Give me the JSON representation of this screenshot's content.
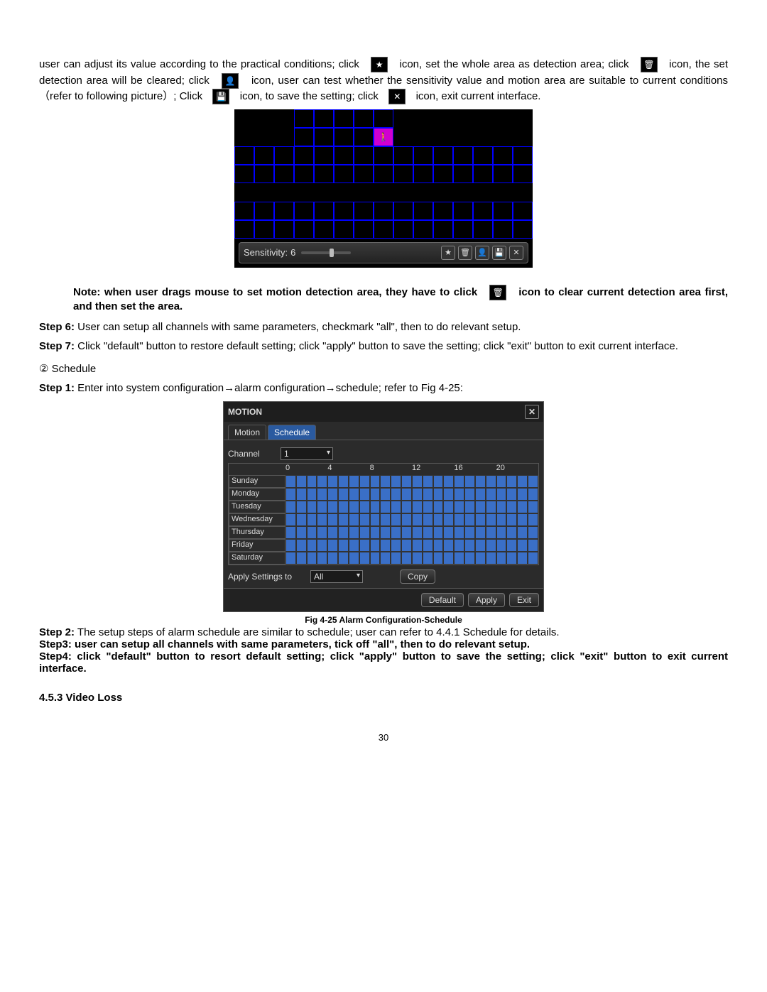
{
  "intro": {
    "p1a": "user can adjust its value according to the practical conditions; click",
    "p1b": "icon, set the whole area as detection area; click",
    "p1c": "icon, the set detection area will be cleared; click",
    "p1d": "icon, user can test whether the sensitivity value and motion area are suitable to current conditions（refer to following picture）; Click",
    "p1e": "icon, to save the setting; click",
    "p1f": "icon, exit current interface."
  },
  "icons": {
    "star": "★",
    "trash": "🗑",
    "person": "👤",
    "save": "💾",
    "close": "✕",
    "walk": "🚶"
  },
  "motion_bar": {
    "label": "Sensitivity:",
    "value": "6"
  },
  "note": {
    "a": "Note: when user drags mouse to set motion detection area, they have to click",
    "b": "icon to clear current detection area first, and then set the area."
  },
  "step6": {
    "label": "Step 6:",
    "text": " User can setup all channels with same parameters, checkmark \"all\", then to do relevant setup."
  },
  "step7": {
    "label": "Step 7:",
    "text": " Click \"default\" button to restore default setting; click \"apply\" button to save the setting; click \"exit\" button to exit current interface."
  },
  "schedule_label": "②  Schedule",
  "step1": {
    "label": "Step 1:",
    "text": " Enter into system configuration→alarm configuration→schedule; refer to Fig 4-25:"
  },
  "dialog": {
    "title": "MOTION",
    "tab_motion": "Motion",
    "tab_schedule": "Schedule",
    "channel_label": "Channel",
    "channel_value": "1",
    "hours": [
      "0",
      "4",
      "8",
      "12",
      "16",
      "20"
    ],
    "days": [
      "Sunday",
      "Monday",
      "Tuesday",
      "Wednesday",
      "Thursday",
      "Friday",
      "Saturday"
    ],
    "apply_label": "Apply Settings to",
    "apply_value": "All",
    "copy": "Copy",
    "default": "Default",
    "apply": "Apply",
    "exit": "Exit"
  },
  "caption": "Fig 4-25 Alarm Configuration-Schedule",
  "step2": {
    "label": "Step 2:",
    "text": " The setup steps of alarm schedule are similar to schedule; user can refer to 4.4.1 Schedule for details."
  },
  "step3": "Step3: user can setup all channels with same parameters, tick off \"all\", then to do relevant setup.",
  "step4": "Step4: click \"default\" button to resort default setting; click \"apply\" button to save the setting; click \"exit\" button to exit current interface.",
  "section": "4.5.3 Video Loss",
  "page_number": "30"
}
